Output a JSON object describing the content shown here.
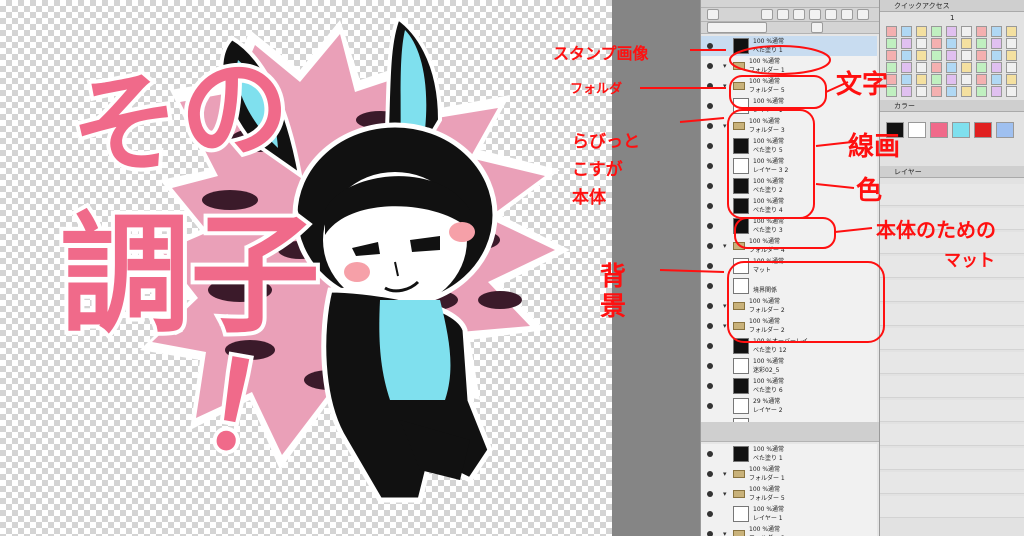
{
  "canvas": {
    "stamp_text": [
      "その",
      "調子",
      "！"
    ],
    "colors": {
      "pink": "#f06a8a",
      "cyan": "#7fe0ee",
      "black": "#111111",
      "cheek": "#f6a0a8",
      "camo_dark": "#3a1a28",
      "camo_light": "#f0a0bc",
      "white": "#ffffff"
    }
  },
  "layer_panel": {
    "layers": [
      {
        "l1": "100 %通常",
        "l2": "ベた塗り 1",
        "type": "fill",
        "selected": true
      },
      {
        "l1": "100 %通常",
        "l2": "フォルダー 1",
        "type": "folder",
        "selected": false
      },
      {
        "l1": "100 %通常",
        "l2": "フォルダー 5",
        "type": "folder",
        "selected": false
      },
      {
        "l1": "100 %通常",
        "l2": "レイヤー 1",
        "type": "layer",
        "selected": false
      },
      {
        "l1": "100 %通常",
        "l2": "フォルダー 3",
        "type": "folder",
        "selected": false
      },
      {
        "l1": "100 %通常",
        "l2": "ベた塗り 5",
        "type": "fill",
        "selected": false
      },
      {
        "l1": "100 %通常",
        "l2": "レイヤー 3 2",
        "type": "layer",
        "selected": false
      },
      {
        "l1": "100 %通常",
        "l2": "ベた塗り 2",
        "type": "fill",
        "selected": false
      },
      {
        "l1": "100 %通常",
        "l2": "ベた塗り 4",
        "type": "fill",
        "selected": false
      },
      {
        "l1": "100 %通常",
        "l2": "ベた塗り 3",
        "type": "fill",
        "selected": false
      },
      {
        "l1": "100 %通常",
        "l2": "フォルダー 4",
        "type": "folder",
        "selected": false
      },
      {
        "l1": "100 %通常",
        "l2": "マット",
        "type": "layer",
        "selected": false
      },
      {
        "l1": "",
        "l2": "境界関係",
        "type": "layer",
        "selected": false
      },
      {
        "l1": "100 %通常",
        "l2": "フォルダー 2",
        "type": "folder",
        "selected": false
      },
      {
        "l1": "100 %通常",
        "l2": "フォルダー 2",
        "type": "folder",
        "selected": false
      },
      {
        "l1": "100 %オーバーレイ",
        "l2": "ベた塗り 12",
        "type": "fill",
        "selected": false
      },
      {
        "l1": "100 %通常",
        "l2": "迷彩02_5",
        "type": "layer",
        "selected": false
      },
      {
        "l1": "100 %通常",
        "l2": "ベた塗り 6",
        "type": "fill",
        "selected": false
      },
      {
        "l1": "29 %通常",
        "l2": "レイヤー 2",
        "type": "layer",
        "selected": false
      },
      {
        "l1": "",
        "l2": "用紙",
        "type": "paper",
        "selected": false
      }
    ],
    "lower_layers": [
      {
        "l1": "100 %通常",
        "l2": "ベた塗り 1",
        "type": "fill"
      },
      {
        "l1": "100 %通常",
        "l2": "フォルダー 1",
        "type": "folder"
      },
      {
        "l1": "100 %通常",
        "l2": "フォルダー 5",
        "type": "folder"
      },
      {
        "l1": "100 %通常",
        "l2": "レイヤー 1",
        "type": "layer"
      },
      {
        "l1": "100 %通常",
        "l2": "フォルダー 3",
        "type": "folder"
      }
    ]
  },
  "right_dock": {
    "quick_access_title": "クイックアクセス",
    "second_title": "カラー",
    "layer_title": "レイヤー",
    "value_readout": "1"
  },
  "annotations": {
    "stamp_image": "スタンプ画像",
    "folder": "フォルダ",
    "moji": "文字",
    "rabbit": [
      "らびっと",
      "こすが",
      "本体"
    ],
    "lineart": "線画",
    "color": "色",
    "matte": "本体のための",
    "matte2": "マット",
    "background": "背景"
  }
}
